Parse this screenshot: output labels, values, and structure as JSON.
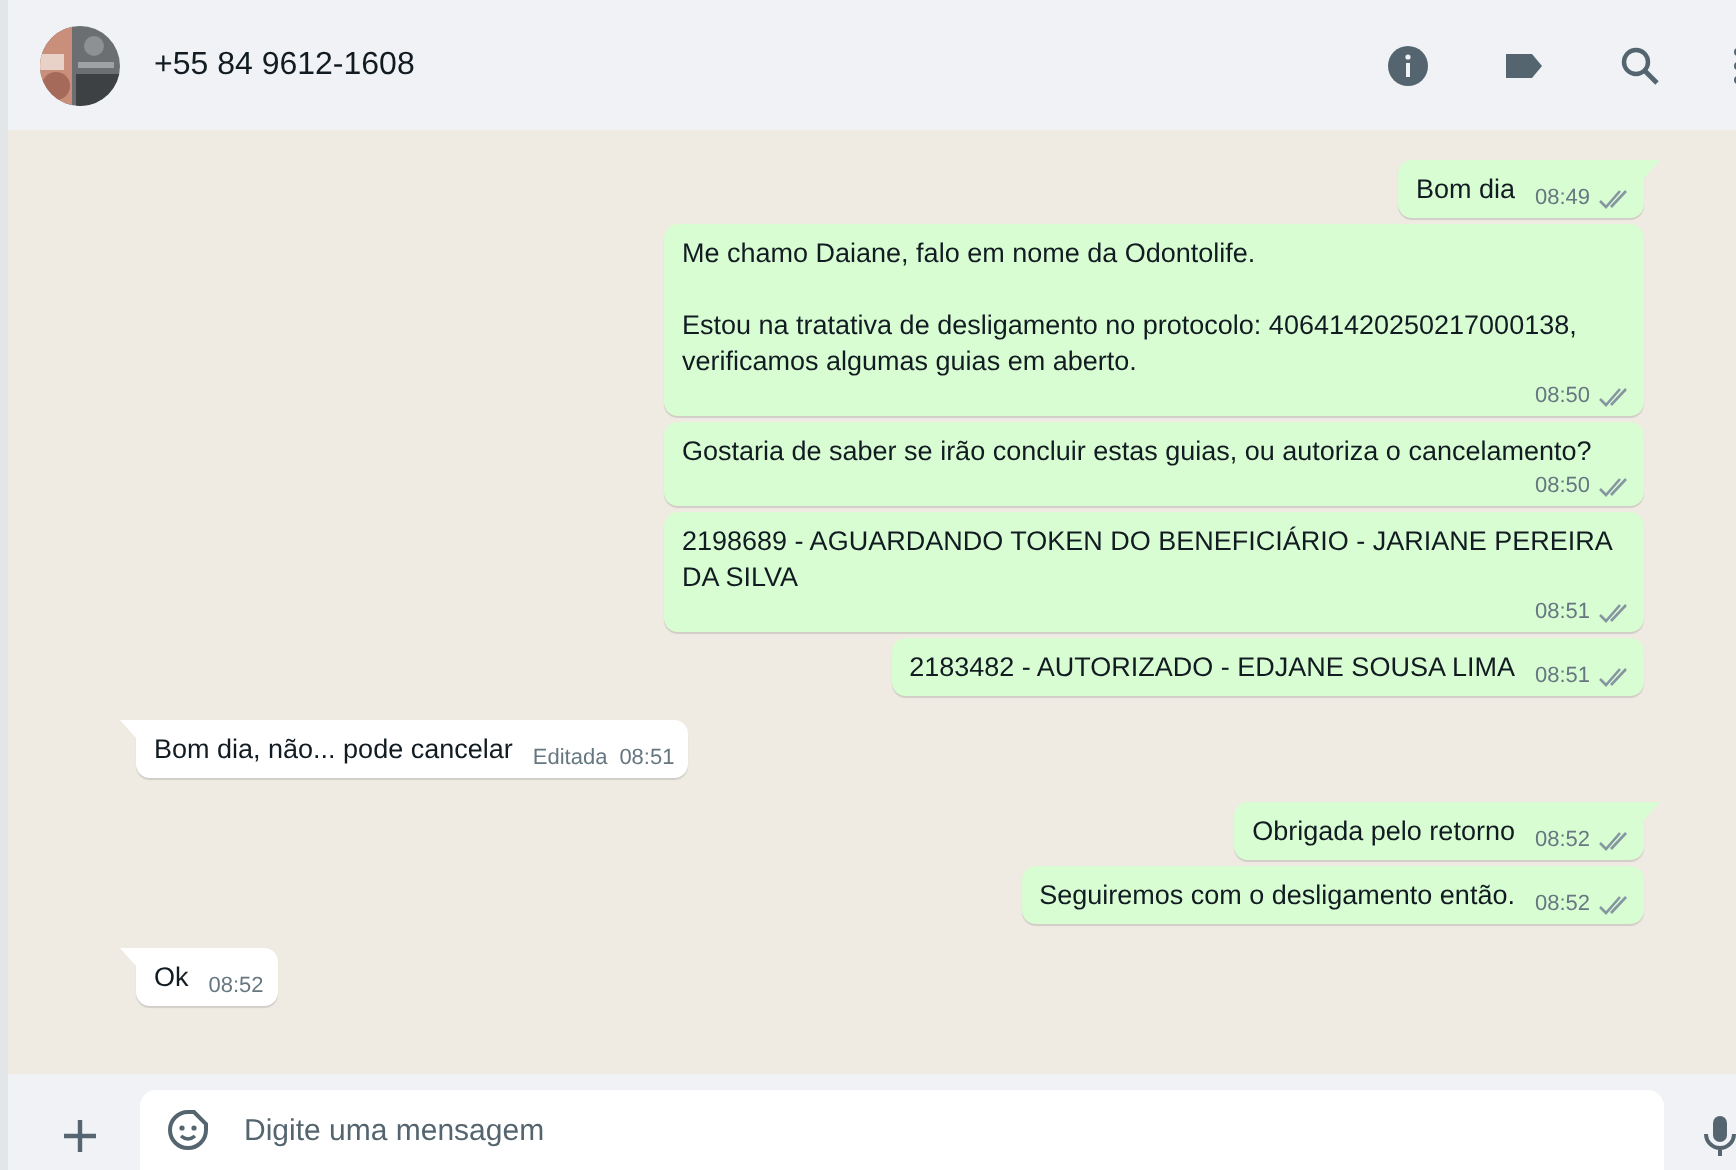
{
  "header": {
    "contact": "+55 84 9612-1608"
  },
  "messages": [
    {
      "kind": "sent",
      "tail": true,
      "text": "Bom dia",
      "time": "08:49",
      "delivered": true
    },
    {
      "kind": "sent",
      "tail": false,
      "text": "Me chamo Daiane, falo em nome da Odontolife.\n\nEstou na tratativa de desligamento no protocolo: 40641420250217000138, verificamos algumas guias em aberto.",
      "time": "08:50",
      "delivered": true
    },
    {
      "kind": "sent",
      "tail": false,
      "text": "Gostaria de saber se irão concluir estas guias, ou autoriza o cancelamento?",
      "time": "08:50",
      "delivered": true
    },
    {
      "kind": "sent",
      "tail": false,
      "text": "2198689 - AGUARDANDO TOKEN DO BENEFICIÁRIO - JARIANE PEREIRA DA SILVA",
      "time": "08:51",
      "delivered": true
    },
    {
      "kind": "sent",
      "tail": false,
      "text": "2183482 - AUTORIZADO - EDJANE SOUSA LIMA",
      "time": "08:51",
      "delivered": true
    },
    {
      "kind": "received",
      "tail": true,
      "text": "Bom dia, não... pode cancelar",
      "edited": "Editada",
      "time": "08:51"
    },
    {
      "kind": "sent",
      "tail": true,
      "text": "Obrigada pelo retorno",
      "time": "08:52",
      "delivered": true
    },
    {
      "kind": "sent",
      "tail": false,
      "text": "Seguiremos com o desligamento então.",
      "time": "08:52",
      "delivered": true
    },
    {
      "kind": "received",
      "tail": true,
      "text": "Ok",
      "time": "08:52"
    }
  ],
  "composer": {
    "placeholder": "Digite uma mensagem"
  }
}
